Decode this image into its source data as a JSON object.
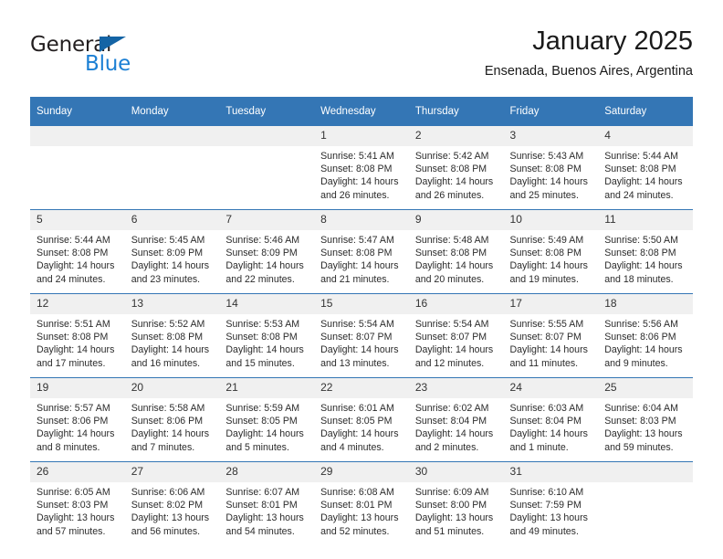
{
  "brand": {
    "name_top": "General",
    "name_bottom": "Blue",
    "triangle_color": "#1464a5",
    "blue_color": "#1b7fd4"
  },
  "header": {
    "title": "January 2025",
    "subtitle": "Ensenada, Buenos Aires, Argentina",
    "header_bg": "#3476b5",
    "header_text_color": "#ffffff",
    "daynum_bg": "#f0f0f0"
  },
  "weekdays": [
    "Sunday",
    "Monday",
    "Tuesday",
    "Wednesday",
    "Thursday",
    "Friday",
    "Saturday"
  ],
  "weeks": [
    [
      {
        "day": "",
        "empty": true
      },
      {
        "day": "",
        "empty": true
      },
      {
        "day": "",
        "empty": true
      },
      {
        "day": "1",
        "sunrise": "Sunrise: 5:41 AM",
        "sunset": "Sunset: 8:08 PM",
        "daylight": "Daylight: 14 hours and 26 minutes."
      },
      {
        "day": "2",
        "sunrise": "Sunrise: 5:42 AM",
        "sunset": "Sunset: 8:08 PM",
        "daylight": "Daylight: 14 hours and 26 minutes."
      },
      {
        "day": "3",
        "sunrise": "Sunrise: 5:43 AM",
        "sunset": "Sunset: 8:08 PM",
        "daylight": "Daylight: 14 hours and 25 minutes."
      },
      {
        "day": "4",
        "sunrise": "Sunrise: 5:44 AM",
        "sunset": "Sunset: 8:08 PM",
        "daylight": "Daylight: 14 hours and 24 minutes."
      }
    ],
    [
      {
        "day": "5",
        "sunrise": "Sunrise: 5:44 AM",
        "sunset": "Sunset: 8:08 PM",
        "daylight": "Daylight: 14 hours and 24 minutes."
      },
      {
        "day": "6",
        "sunrise": "Sunrise: 5:45 AM",
        "sunset": "Sunset: 8:09 PM",
        "daylight": "Daylight: 14 hours and 23 minutes."
      },
      {
        "day": "7",
        "sunrise": "Sunrise: 5:46 AM",
        "sunset": "Sunset: 8:09 PM",
        "daylight": "Daylight: 14 hours and 22 minutes."
      },
      {
        "day": "8",
        "sunrise": "Sunrise: 5:47 AM",
        "sunset": "Sunset: 8:08 PM",
        "daylight": "Daylight: 14 hours and 21 minutes."
      },
      {
        "day": "9",
        "sunrise": "Sunrise: 5:48 AM",
        "sunset": "Sunset: 8:08 PM",
        "daylight": "Daylight: 14 hours and 20 minutes."
      },
      {
        "day": "10",
        "sunrise": "Sunrise: 5:49 AM",
        "sunset": "Sunset: 8:08 PM",
        "daylight": "Daylight: 14 hours and 19 minutes."
      },
      {
        "day": "11",
        "sunrise": "Sunrise: 5:50 AM",
        "sunset": "Sunset: 8:08 PM",
        "daylight": "Daylight: 14 hours and 18 minutes."
      }
    ],
    [
      {
        "day": "12",
        "sunrise": "Sunrise: 5:51 AM",
        "sunset": "Sunset: 8:08 PM",
        "daylight": "Daylight: 14 hours and 17 minutes."
      },
      {
        "day": "13",
        "sunrise": "Sunrise: 5:52 AM",
        "sunset": "Sunset: 8:08 PM",
        "daylight": "Daylight: 14 hours and 16 minutes."
      },
      {
        "day": "14",
        "sunrise": "Sunrise: 5:53 AM",
        "sunset": "Sunset: 8:08 PM",
        "daylight": "Daylight: 14 hours and 15 minutes."
      },
      {
        "day": "15",
        "sunrise": "Sunrise: 5:54 AM",
        "sunset": "Sunset: 8:07 PM",
        "daylight": "Daylight: 14 hours and 13 minutes."
      },
      {
        "day": "16",
        "sunrise": "Sunrise: 5:54 AM",
        "sunset": "Sunset: 8:07 PM",
        "daylight": "Daylight: 14 hours and 12 minutes."
      },
      {
        "day": "17",
        "sunrise": "Sunrise: 5:55 AM",
        "sunset": "Sunset: 8:07 PM",
        "daylight": "Daylight: 14 hours and 11 minutes."
      },
      {
        "day": "18",
        "sunrise": "Sunrise: 5:56 AM",
        "sunset": "Sunset: 8:06 PM",
        "daylight": "Daylight: 14 hours and 9 minutes."
      }
    ],
    [
      {
        "day": "19",
        "sunrise": "Sunrise: 5:57 AM",
        "sunset": "Sunset: 8:06 PM",
        "daylight": "Daylight: 14 hours and 8 minutes."
      },
      {
        "day": "20",
        "sunrise": "Sunrise: 5:58 AM",
        "sunset": "Sunset: 8:06 PM",
        "daylight": "Daylight: 14 hours and 7 minutes."
      },
      {
        "day": "21",
        "sunrise": "Sunrise: 5:59 AM",
        "sunset": "Sunset: 8:05 PM",
        "daylight": "Daylight: 14 hours and 5 minutes."
      },
      {
        "day": "22",
        "sunrise": "Sunrise: 6:01 AM",
        "sunset": "Sunset: 8:05 PM",
        "daylight": "Daylight: 14 hours and 4 minutes."
      },
      {
        "day": "23",
        "sunrise": "Sunrise: 6:02 AM",
        "sunset": "Sunset: 8:04 PM",
        "daylight": "Daylight: 14 hours and 2 minutes."
      },
      {
        "day": "24",
        "sunrise": "Sunrise: 6:03 AM",
        "sunset": "Sunset: 8:04 PM",
        "daylight": "Daylight: 14 hours and 1 minute."
      },
      {
        "day": "25",
        "sunrise": "Sunrise: 6:04 AM",
        "sunset": "Sunset: 8:03 PM",
        "daylight": "Daylight: 13 hours and 59 minutes."
      }
    ],
    [
      {
        "day": "26",
        "sunrise": "Sunrise: 6:05 AM",
        "sunset": "Sunset: 8:03 PM",
        "daylight": "Daylight: 13 hours and 57 minutes."
      },
      {
        "day": "27",
        "sunrise": "Sunrise: 6:06 AM",
        "sunset": "Sunset: 8:02 PM",
        "daylight": "Daylight: 13 hours and 56 minutes."
      },
      {
        "day": "28",
        "sunrise": "Sunrise: 6:07 AM",
        "sunset": "Sunset: 8:01 PM",
        "daylight": "Daylight: 13 hours and 54 minutes."
      },
      {
        "day": "29",
        "sunrise": "Sunrise: 6:08 AM",
        "sunset": "Sunset: 8:01 PM",
        "daylight": "Daylight: 13 hours and 52 minutes."
      },
      {
        "day": "30",
        "sunrise": "Sunrise: 6:09 AM",
        "sunset": "Sunset: 8:00 PM",
        "daylight": "Daylight: 13 hours and 51 minutes."
      },
      {
        "day": "31",
        "sunrise": "Sunrise: 6:10 AM",
        "sunset": "Sunset: 7:59 PM",
        "daylight": "Daylight: 13 hours and 49 minutes."
      },
      {
        "day": "",
        "empty": true
      }
    ]
  ]
}
